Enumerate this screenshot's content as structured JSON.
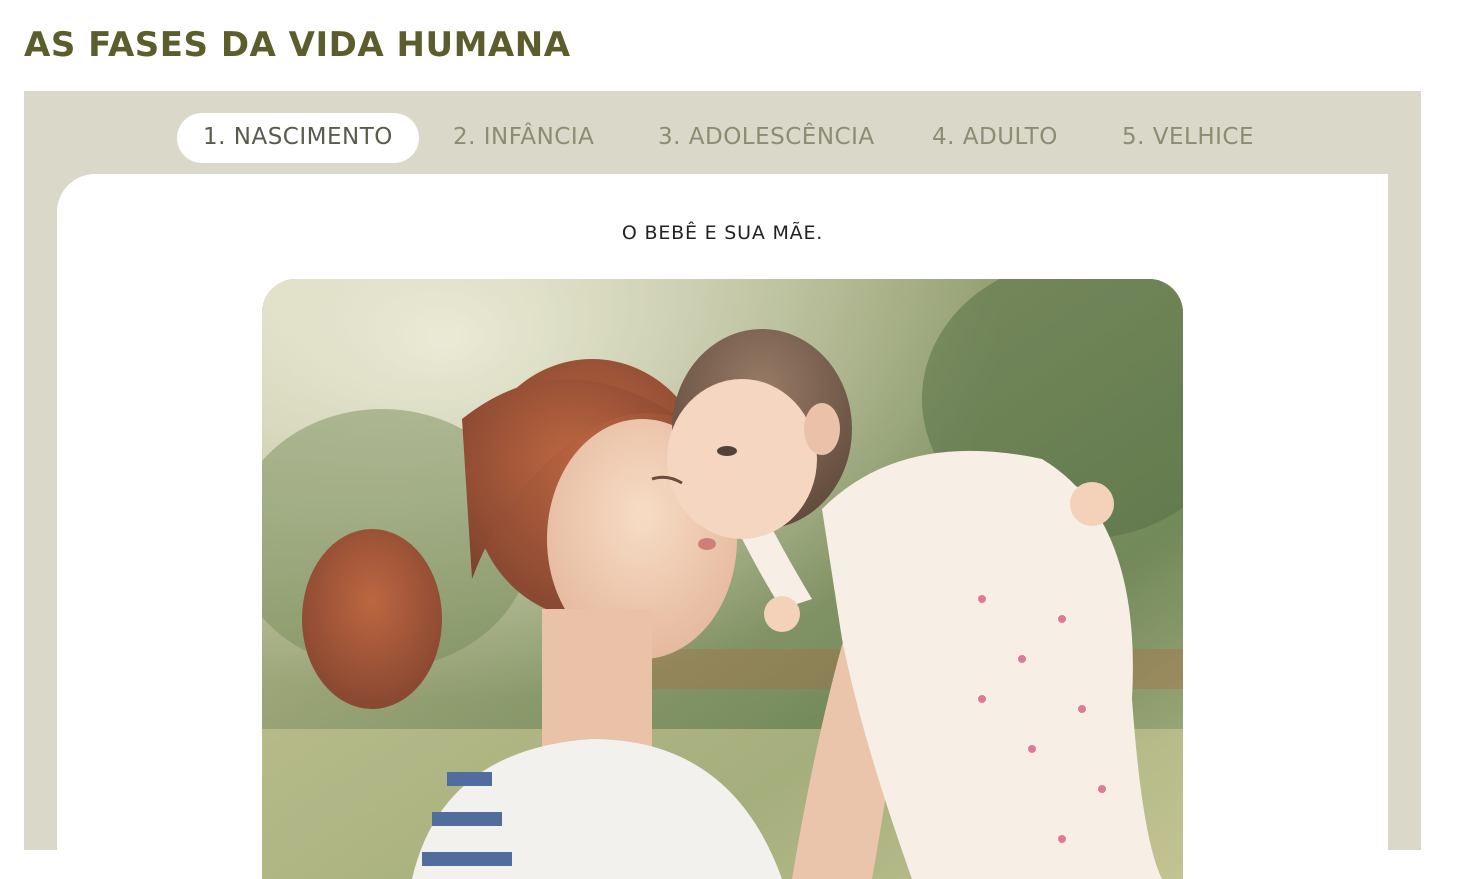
{
  "page": {
    "title": "AS FASES DA VIDA HUMANA"
  },
  "tabs": [
    {
      "label": "1. NASCIMENTO",
      "active": true
    },
    {
      "label": "2. INFÂNCIA",
      "active": false
    },
    {
      "label": "3. ADOLESCÊNCIA",
      "active": false
    },
    {
      "label": "4. ADULTO",
      "active": false
    },
    {
      "label": "5. VELHICE",
      "active": false
    }
  ],
  "content": {
    "caption": "O BEBÊ E SUA MÃE.",
    "image": {
      "subject": "mother-holding-baby-photo"
    }
  },
  "colors": {
    "title": "#5b5e2c",
    "frame": "#d9d8c9",
    "tab_inactive": "#8c8c72",
    "tab_active_bg": "#ffffff"
  }
}
